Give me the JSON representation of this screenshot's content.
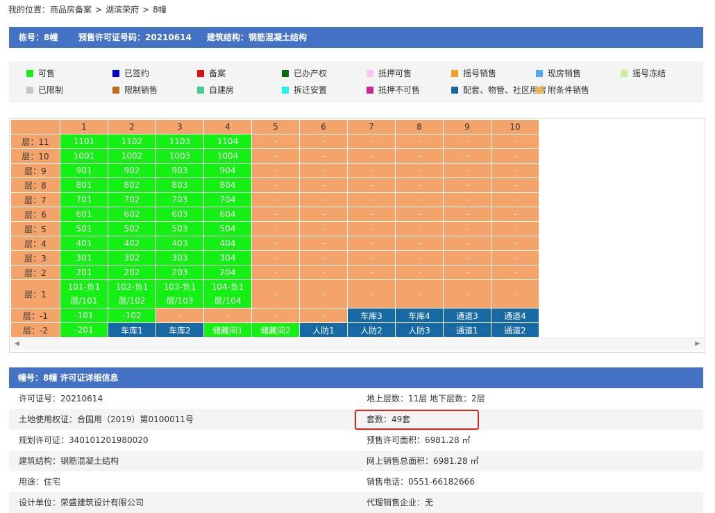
{
  "breadcrumb": {
    "label": "我的位置：",
    "items": [
      "商品房备案",
      "湖滨荣府",
      "8幢"
    ],
    "sep": ">"
  },
  "building_info": {
    "building_no": "栋号：8幢",
    "presale_no": "预售许可证号码：20210614",
    "structure": "建筑结构：钢筋混凝土结构"
  },
  "legend": [
    {
      "label": "可售",
      "color": "#14f014"
    },
    {
      "label": "已签约",
      "color": "#0000cc"
    },
    {
      "label": "备案",
      "color": "#e01010"
    },
    {
      "label": "已办产权",
      "color": "#0a6b0a"
    },
    {
      "label": "抵押可售",
      "color": "#f7c6f2"
    },
    {
      "label": "摇号销售",
      "color": "#f5a020"
    },
    {
      "label": "现房销售",
      "color": "#54a6f0"
    },
    {
      "label": "摇号冻结",
      "color": "#c4f09a"
    },
    {
      "label": "已限制",
      "color": "#c6c6c6"
    },
    {
      "label": "限制销售",
      "color": "#c46a1c"
    },
    {
      "label": "自建房",
      "color": "#3ccf8e"
    },
    {
      "label": "拆迁安置",
      "color": "#22f0f0"
    },
    {
      "label": "抵押不可售",
      "color": "#d0248e"
    },
    {
      "label": "配套、物管、社区用房",
      "color": "#1669a3"
    },
    {
      "label": "附条件销售",
      "color": "#e8b84a"
    }
  ],
  "grid": {
    "columns": [
      "1",
      "2",
      "3",
      "4",
      "5",
      "6",
      "7",
      "8",
      "9",
      "10"
    ],
    "rows": [
      {
        "floor": "层：11",
        "cells": [
          [
            "1101",
            "av"
          ],
          [
            "1102",
            "av"
          ],
          [
            "1103",
            "av"
          ],
          [
            "1104",
            "av"
          ],
          [
            "-",
            "em"
          ],
          [
            "-",
            "em"
          ],
          [
            "-",
            "em"
          ],
          [
            "-",
            "em"
          ],
          [
            "-",
            "em"
          ],
          [
            "-",
            "em"
          ]
        ]
      },
      {
        "floor": "层：10",
        "cells": [
          [
            "1001",
            "av"
          ],
          [
            "1002",
            "av"
          ],
          [
            "1003",
            "av"
          ],
          [
            "1004",
            "av"
          ],
          [
            "-",
            "em"
          ],
          [
            "-",
            "em"
          ],
          [
            "-",
            "em"
          ],
          [
            "-",
            "em"
          ],
          [
            "-",
            "em"
          ],
          [
            "-",
            "em"
          ]
        ]
      },
      {
        "floor": "层：9",
        "cells": [
          [
            "901",
            "av"
          ],
          [
            "902",
            "av"
          ],
          [
            "903",
            "av"
          ],
          [
            "904",
            "av"
          ],
          [
            "-",
            "em"
          ],
          [
            "-",
            "em"
          ],
          [
            "-",
            "em"
          ],
          [
            "-",
            "em"
          ],
          [
            "-",
            "em"
          ],
          [
            "-",
            "em"
          ]
        ]
      },
      {
        "floor": "层：8",
        "cells": [
          [
            "801",
            "av"
          ],
          [
            "802",
            "av"
          ],
          [
            "803",
            "av"
          ],
          [
            "804",
            "av"
          ],
          [
            "-",
            "em"
          ],
          [
            "-",
            "em"
          ],
          [
            "-",
            "em"
          ],
          [
            "-",
            "em"
          ],
          [
            "-",
            "em"
          ],
          [
            "-",
            "em"
          ]
        ]
      },
      {
        "floor": "层：7",
        "cells": [
          [
            "701",
            "av"
          ],
          [
            "702",
            "av"
          ],
          [
            "703",
            "av"
          ],
          [
            "704",
            "av"
          ],
          [
            "-",
            "em"
          ],
          [
            "-",
            "em"
          ],
          [
            "-",
            "em"
          ],
          [
            "-",
            "em"
          ],
          [
            "-",
            "em"
          ],
          [
            "-",
            "em"
          ]
        ]
      },
      {
        "floor": "层：6",
        "cells": [
          [
            "601",
            "av"
          ],
          [
            "602",
            "av"
          ],
          [
            "603",
            "av"
          ],
          [
            "604",
            "av"
          ],
          [
            "-",
            "em"
          ],
          [
            "-",
            "em"
          ],
          [
            "-",
            "em"
          ],
          [
            "-",
            "em"
          ],
          [
            "-",
            "em"
          ],
          [
            "-",
            "em"
          ]
        ]
      },
      {
        "floor": "层：5",
        "cells": [
          [
            "501",
            "av"
          ],
          [
            "502",
            "av"
          ],
          [
            "503",
            "av"
          ],
          [
            "504",
            "av"
          ],
          [
            "-",
            "em"
          ],
          [
            "-",
            "em"
          ],
          [
            "-",
            "em"
          ],
          [
            "-",
            "em"
          ],
          [
            "-",
            "em"
          ],
          [
            "-",
            "em"
          ]
        ]
      },
      {
        "floor": "层：4",
        "cells": [
          [
            "401",
            "av"
          ],
          [
            "402",
            "av"
          ],
          [
            "403",
            "av"
          ],
          [
            "404",
            "av"
          ],
          [
            "-",
            "em"
          ],
          [
            "-",
            "em"
          ],
          [
            "-",
            "em"
          ],
          [
            "-",
            "em"
          ],
          [
            "-",
            "em"
          ],
          [
            "-",
            "em"
          ]
        ]
      },
      {
        "floor": "层：3",
        "cells": [
          [
            "301",
            "av"
          ],
          [
            "302",
            "av"
          ],
          [
            "303",
            "av"
          ],
          [
            "304",
            "av"
          ],
          [
            "-",
            "em"
          ],
          [
            "-",
            "em"
          ],
          [
            "-",
            "em"
          ],
          [
            "-",
            "em"
          ],
          [
            "-",
            "em"
          ],
          [
            "-",
            "em"
          ]
        ]
      },
      {
        "floor": "层：2",
        "cells": [
          [
            "201",
            "av"
          ],
          [
            "202",
            "av"
          ],
          [
            "203",
            "av"
          ],
          [
            "204",
            "av"
          ],
          [
            "-",
            "em"
          ],
          [
            "-",
            "em"
          ],
          [
            "-",
            "em"
          ],
          [
            "-",
            "em"
          ],
          [
            "-",
            "em"
          ],
          [
            "-",
            "em"
          ]
        ]
      },
      {
        "floor": "层：1",
        "tall": true,
        "cells": [
          [
            "101-负1层/101",
            "av"
          ],
          [
            "102-负1层/102",
            "av"
          ],
          [
            "103-负1层/103",
            "av"
          ],
          [
            "104-负1层/104",
            "av"
          ],
          [
            "-",
            "em"
          ],
          [
            "-",
            "em"
          ],
          [
            "-",
            "em"
          ],
          [
            "-",
            "em"
          ],
          [
            "-",
            "em"
          ],
          [
            "-",
            "em"
          ]
        ]
      },
      {
        "floor": "层：-1",
        "cells": [
          [
            "-101",
            "av"
          ],
          [
            "-102",
            "av"
          ],
          [
            "-",
            "em"
          ],
          [
            "-",
            "em"
          ],
          [
            "-",
            "em"
          ],
          [
            "-",
            "em"
          ],
          [
            "车库3",
            "bl"
          ],
          [
            "车库4",
            "bl"
          ],
          [
            "通道3",
            "bl"
          ],
          [
            "通道4",
            "bl"
          ]
        ]
      },
      {
        "floor": "层：-2",
        "cells": [
          [
            "-201",
            "av"
          ],
          [
            "车库1",
            "bl"
          ],
          [
            "车库2",
            "bl"
          ],
          [
            "储藏间1",
            "av"
          ],
          [
            "储藏间2",
            "av"
          ],
          [
            "人防1",
            "bl"
          ],
          [
            "人防2",
            "bl"
          ],
          [
            "人防3",
            "bl"
          ],
          [
            "通道1",
            "bl"
          ],
          [
            "通道2",
            "bl"
          ]
        ]
      }
    ]
  },
  "detail": {
    "title": "幢号：8幢 许可证详细信息",
    "rows": [
      {
        "left": "许可证号：20210614",
        "right": "地上层数：11层  地下层数：2层"
      },
      {
        "left": "土地使用权证：合国用（2019）第0100011号",
        "right": "套数：49套"
      },
      {
        "left": "规划许可证：340101201980020",
        "right": "预售许可面积：6981.28 ㎡"
      },
      {
        "left": "建筑结构：钢筋混凝土结构",
        "right": "网上销售总面积：6981.28 ㎡"
      },
      {
        "left": "用途：住宅",
        "right": "销售电话：0551-66182666"
      },
      {
        "left": "设计单位：荣盛建筑设计有限公司",
        "right": "代理销售企业：无"
      }
    ]
  }
}
